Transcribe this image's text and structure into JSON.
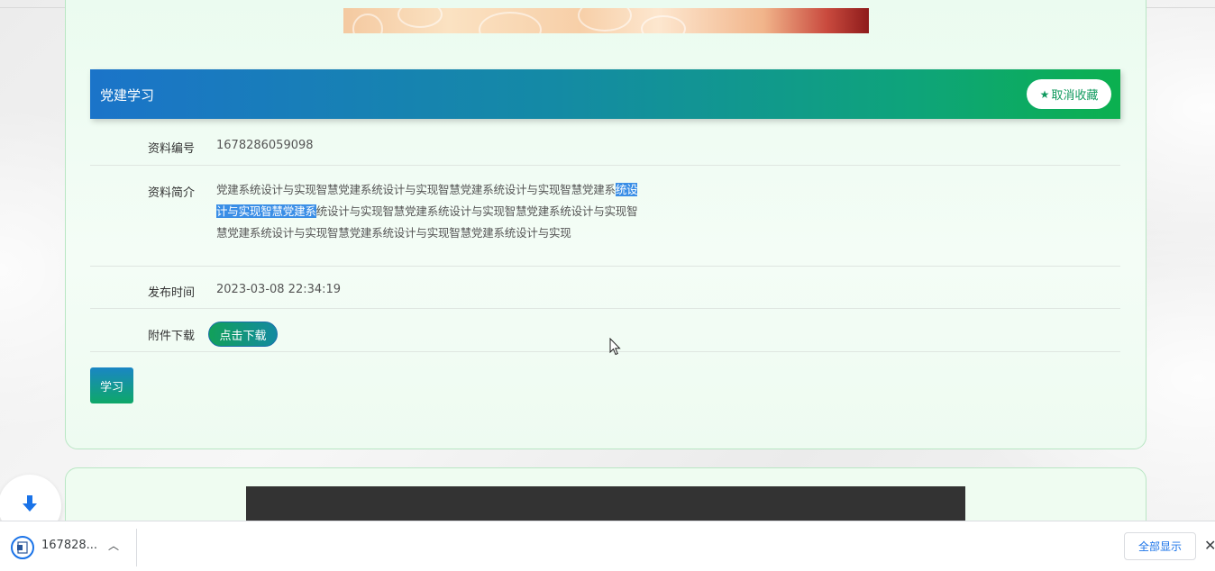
{
  "header": {
    "title": "党建学习",
    "favorite_label": "取消收藏"
  },
  "details": {
    "id_label": "资料编号",
    "id_value": "1678286059098",
    "intro_label": "资料简介",
    "intro_before": "党建系统设计与实现智慧党建系统设计与实现智慧党建系统设计与实现智慧党建系",
    "intro_highlight": "统设计与实现智慧党建系",
    "intro_after": "统设计与实现智慧党建系统设计与实现智慧党建系统设计与实现智慧党建系统设计与实现智慧党建系统设计与实现智慧党建系统设计与实现",
    "time_label": "发布时间",
    "time_value": "2023-03-08 22:34:19",
    "attach_label": "附件下载",
    "download_label": "点击下载"
  },
  "actions": {
    "learn_label": "学习"
  },
  "download_shelf": {
    "file_name": "167828...",
    "show_all_label": "全部显示",
    "close_glyph": "✕"
  }
}
